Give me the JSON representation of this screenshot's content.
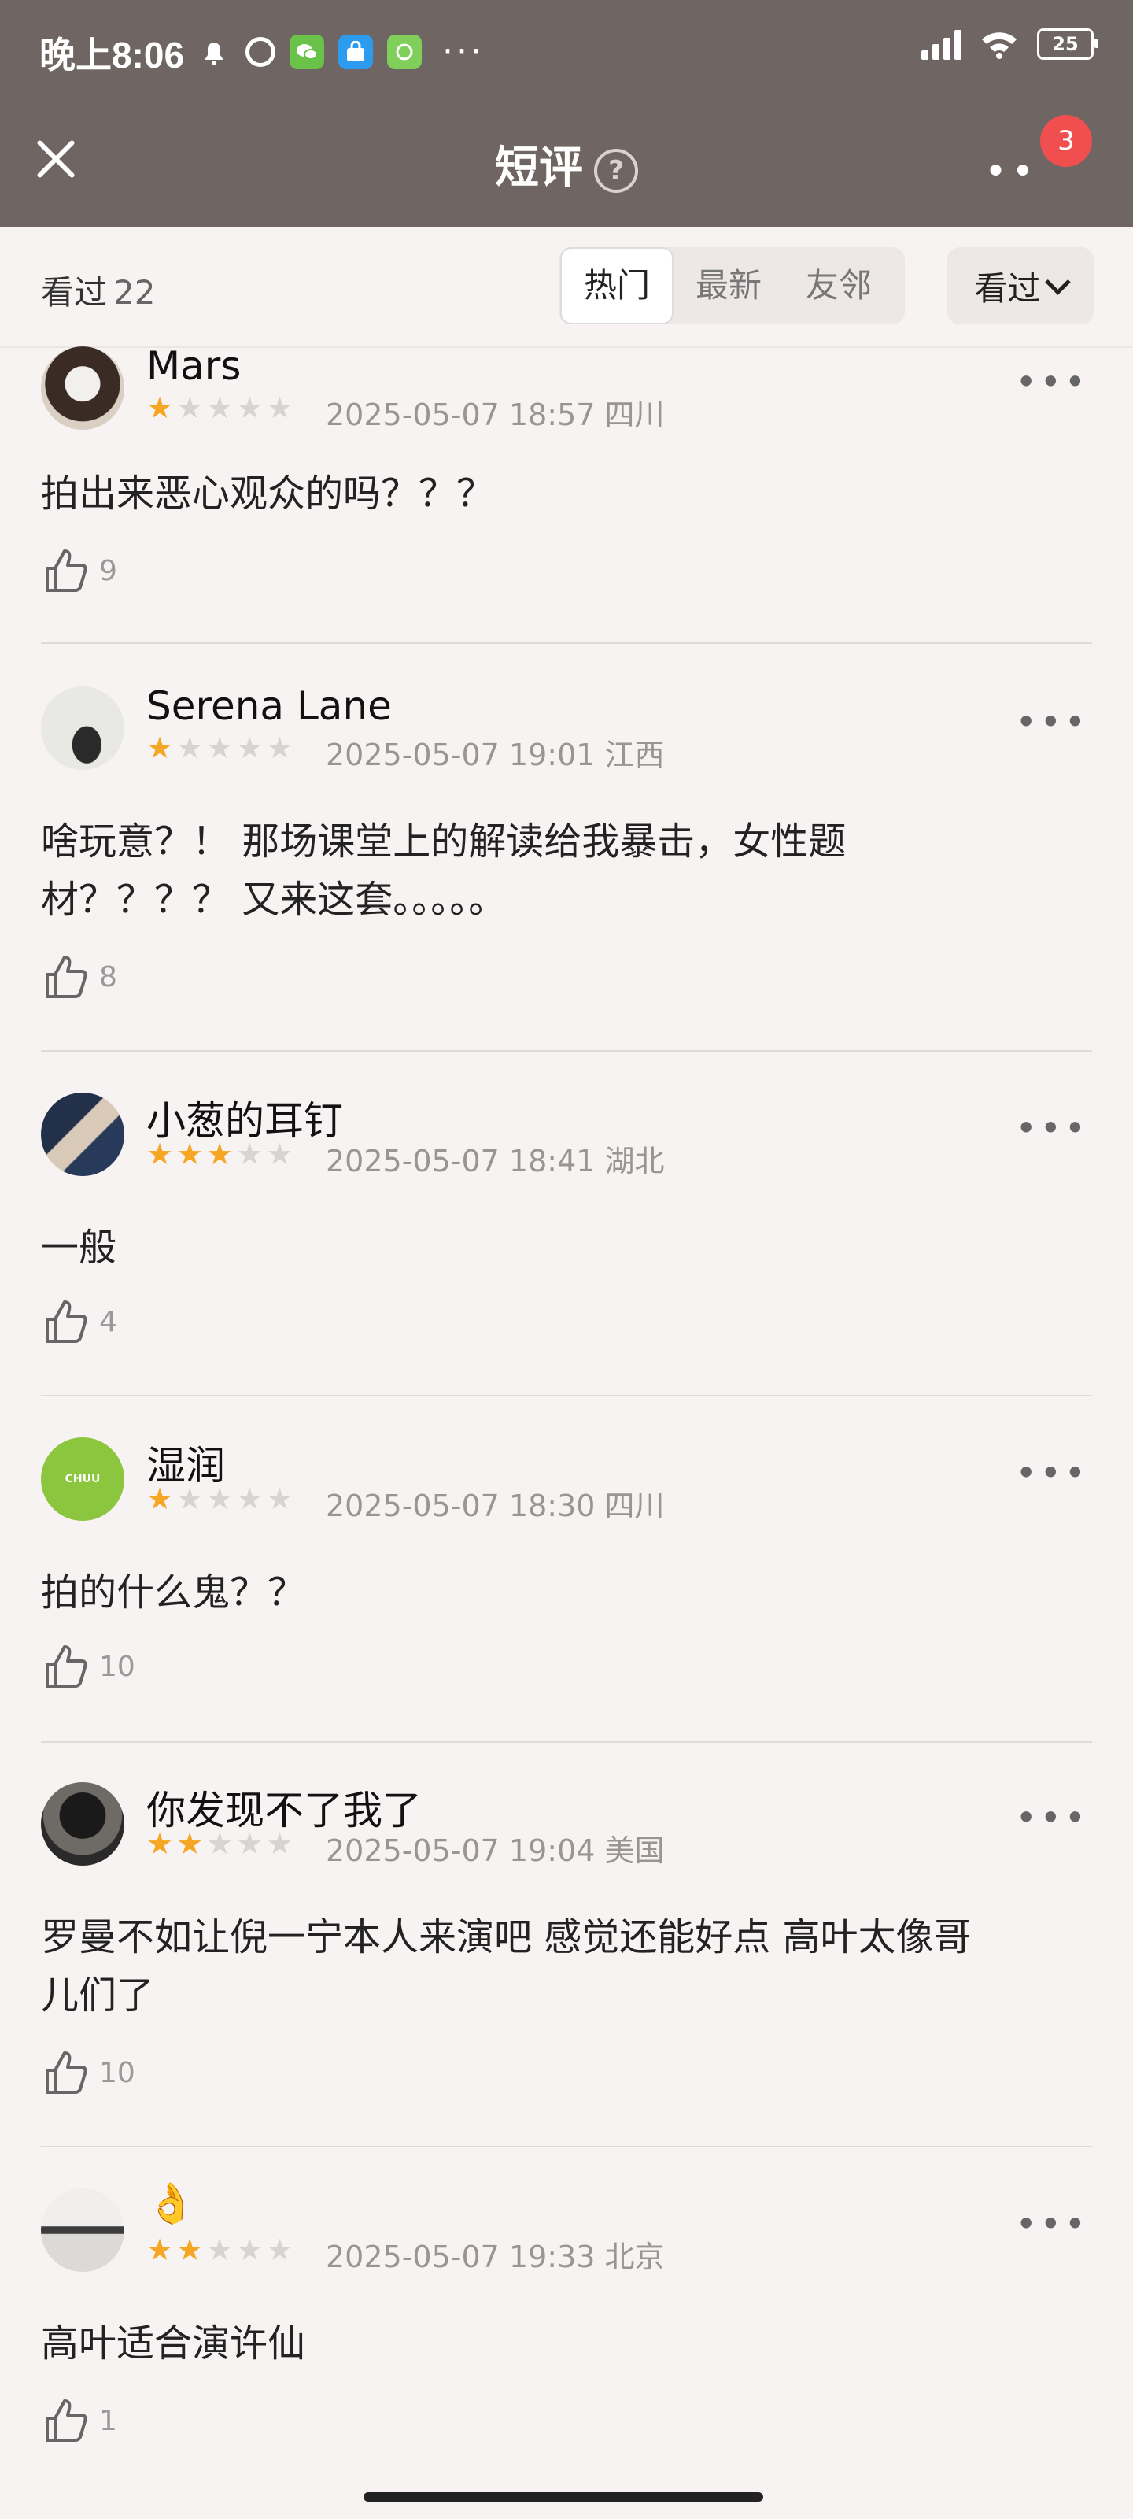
{
  "status_bar": {
    "time": "晚上8:06",
    "battery": "25",
    "more": "···"
  },
  "header": {
    "title": "短评",
    "help": "?",
    "badge": "3"
  },
  "filter": {
    "seen_label": "看过",
    "seen_count": "22",
    "tabs": [
      "热门",
      "最新",
      "友邻"
    ],
    "active_tab": "热门",
    "dropdown_label": "看过"
  },
  "reviews": [
    {
      "name": "Mars",
      "stars": 1,
      "date": "2025-05-07 18:57",
      "region": "四川",
      "text_lines": [
        "拍出来恶心观众的吗？？？"
      ],
      "likes": "9"
    },
    {
      "name": "Serena Lane",
      "stars": 1,
      "date": "2025-05-07 19:01",
      "region": "江西",
      "text_lines": [
        "啥玩意？！ 那场课堂上的解读给我暴击，女性题",
        "材？？？？ 又来这套。。。。。"
      ],
      "likes": "8"
    },
    {
      "name": "小葱的耳钉",
      "stars": 3,
      "date": "2025-05-07 18:41",
      "region": "湖北",
      "text_lines": [
        "一般"
      ],
      "likes": "4"
    },
    {
      "name": "湿润",
      "stars": 1,
      "date": "2025-05-07 18:30",
      "region": "四川",
      "text_lines": [
        "拍的什么鬼？？"
      ],
      "likes": "10"
    },
    {
      "name": "你发现不了我了",
      "stars": 2,
      "date": "2025-05-07 19:04",
      "region": "美国",
      "text_lines": [
        "罗曼不如让倪一宁本人来演吧 感觉还能好点 高叶太像哥",
        "儿们了"
      ],
      "likes": "10"
    },
    {
      "name": "👌",
      "stars": 2,
      "date": "2025-05-07 19:33",
      "region": "北京",
      "text_lines": [
        "高叶适合演许仙"
      ],
      "likes": "1"
    }
  ],
  "avatar_texts": {
    "chuu": "CHUU"
  }
}
